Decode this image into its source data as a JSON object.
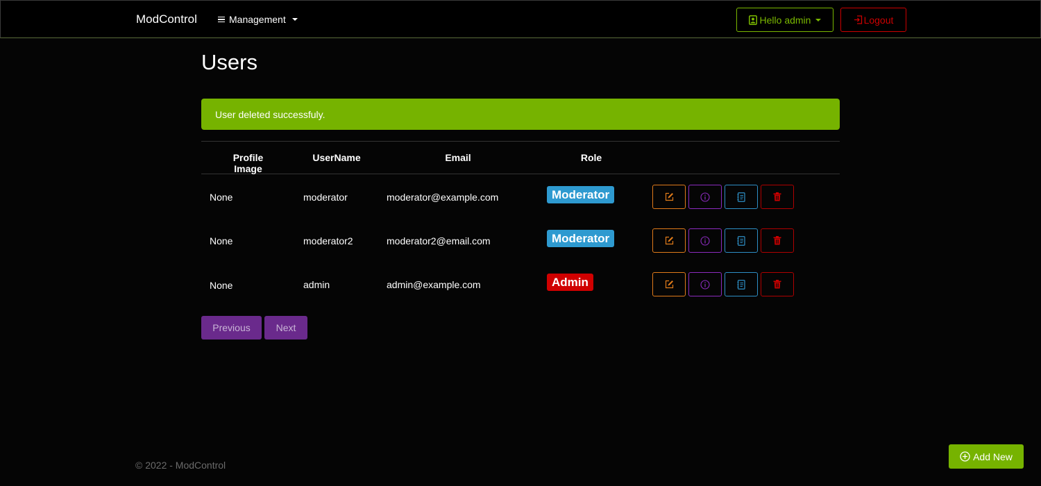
{
  "navbar": {
    "brand": "ModControl",
    "management_label": "Management",
    "hello_label": "Hello admin",
    "logout_label": "Logout"
  },
  "page": {
    "title": "Users"
  },
  "alert": {
    "message": "User deleted successfuly."
  },
  "table": {
    "headers": [
      "Profile Image",
      "UserName",
      "Email",
      "Role"
    ],
    "rows": [
      {
        "image": "None",
        "username": "moderator",
        "email": "moderator@example.com",
        "role": "Moderator"
      },
      {
        "image": "None",
        "username": "moderator2",
        "email": "moderator2@email.com",
        "role": "Moderator"
      },
      {
        "image": "None",
        "username": "admin",
        "email": "admin@example.com",
        "role": "Admin"
      }
    ]
  },
  "pagination": {
    "previous": "Previous",
    "next": "Next"
  },
  "footer": {
    "text": "© 2022 - ModControl"
  },
  "add_new": {
    "label": "Add New"
  },
  "colors": {
    "accent_green": "#76b300",
    "danger_red": "#cc0000",
    "moderator_badge": "#2e9ad0",
    "admin_badge": "#d00000",
    "pager_purple": "#6a2a8c"
  },
  "icons": [
    "hamburger-icon",
    "user-icon",
    "logout-icon",
    "edit-icon",
    "info-icon",
    "details-icon",
    "trash-icon",
    "plus-circle-icon"
  ]
}
